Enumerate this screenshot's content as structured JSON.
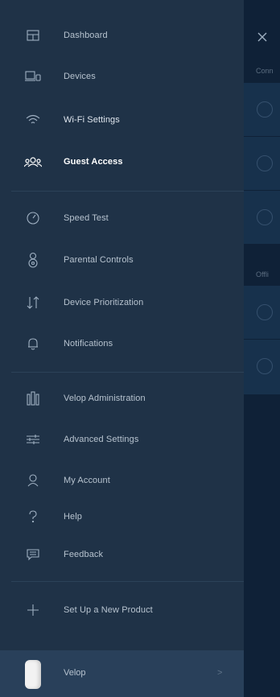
{
  "menu": [
    {
      "label": "Dashboard",
      "icon": "dashboard-icon"
    },
    {
      "label": "Devices",
      "icon": "devices-icon"
    },
    {
      "label": "Wi-Fi Settings",
      "icon": "wifi-icon"
    },
    {
      "label": "Guest Access",
      "icon": "guest-access-icon",
      "active": true
    },
    {
      "label": "Speed Test",
      "icon": "speed-test-icon"
    },
    {
      "label": "Parental Controls",
      "icon": "parental-controls-icon"
    },
    {
      "label": "Device Prioritization",
      "icon": "prioritization-icon"
    },
    {
      "label": "Notifications",
      "icon": "bell-icon"
    },
    {
      "label": "Velop Administration",
      "icon": "velop-admin-icon"
    },
    {
      "label": "Advanced Settings",
      "icon": "sliders-icon"
    },
    {
      "label": "My Account",
      "icon": "user-icon"
    },
    {
      "label": "Help",
      "icon": "help-icon"
    },
    {
      "label": "Feedback",
      "icon": "feedback-icon"
    },
    {
      "label": "Set Up a New Product",
      "icon": "plus-icon"
    }
  ],
  "footer": {
    "label": "Velop",
    "icon": "velop-node-icon",
    "chevron": ">"
  },
  "background": {
    "section_connected": "Conn",
    "section_offline": "Offli"
  },
  "colors": {
    "drawer_bg": "#1f3247",
    "footer_bg": "#29405a",
    "text": "#b7c3cf",
    "active_text": "#ffffff"
  }
}
